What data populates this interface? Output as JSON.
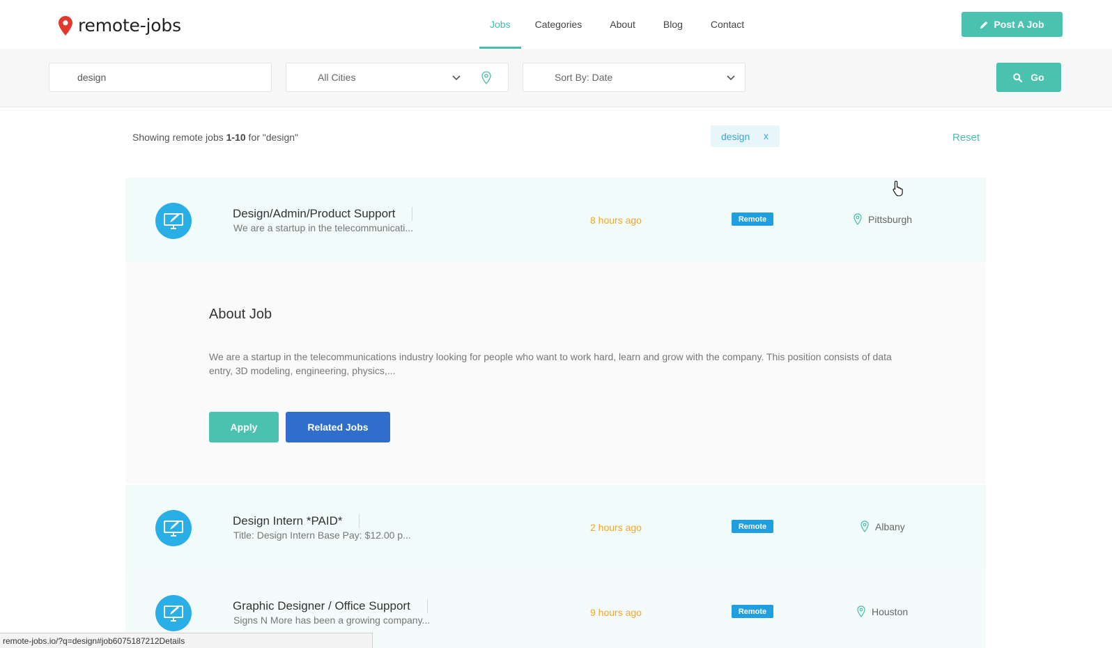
{
  "header": {
    "logo_text": "remote-jobs",
    "nav": [
      "Jobs",
      "Categories",
      "About",
      "Blog",
      "Contact"
    ],
    "post_button": "Post A Job"
  },
  "search": {
    "keyword_value": "design",
    "city_value": "All Cities",
    "sort_value": "Sort By: Date",
    "go_button": "Go"
  },
  "results": {
    "showing_prefix": "Showing remote jobs ",
    "range": "1-10",
    "showing_suffix": " for \"design\"",
    "tag": "design",
    "tag_remove": "x",
    "reset": "Reset"
  },
  "jobs": [
    {
      "title": "Design/Admin/Product Support",
      "desc": "We are a startup in the telecommunicati...",
      "time": "8 hours ago",
      "badge": "Remote",
      "location": "Pittsburgh"
    },
    {
      "title": "Design Intern *PAID*",
      "desc": "Title: Design Intern Base Pay: $12.00 p...",
      "time": "2 hours ago",
      "badge": "Remote",
      "location": "Albany"
    },
    {
      "title": "Graphic Designer / Office Support",
      "desc": "Signs N More has been a growing company...",
      "time": "9 hours ago",
      "badge": "Remote",
      "location": "Houston"
    }
  ],
  "details": {
    "title": "About Job",
    "text": "We are a startup in the telecommunications industry looking for people who want to work hard, learn and grow with the company. This position consists of data entry, 3D modeling, engineering, physics,...",
    "apply_button": "Apply",
    "related_button": "Related Jobs"
  },
  "status_url": "remote-jobs.io/?q=design#job6075187212Details",
  "colors": {
    "accent": "#4bc2b0",
    "blue": "#2f6fcb",
    "badge": "#1f9fe0",
    "time": "#f5a623",
    "logo_pin": "#e2382e"
  },
  "icons": [
    "map-pin-icon",
    "pencil-icon",
    "chevron-down-icon",
    "search-icon",
    "monitor-pen-icon",
    "hand-cursor-icon"
  ]
}
